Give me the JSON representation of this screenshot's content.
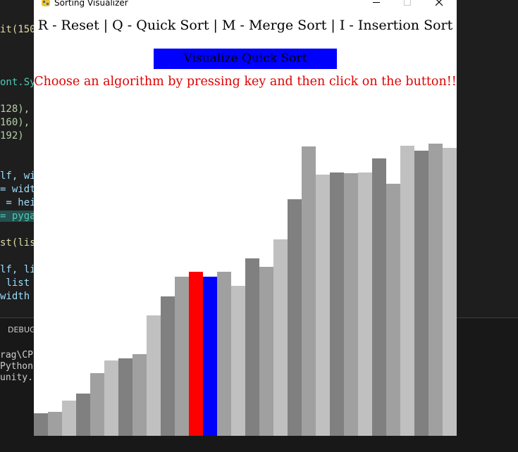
{
  "window": {
    "title": "Sorting Visualizer"
  },
  "controls": {
    "instructions": "R - Reset | Q - Quick Sort | M - Merge Sort | I - Insertion Sort",
    "visualize_button": "Visualize Quick Sort",
    "message": "Choose an algorithm by pressing key and then click on the button!!"
  },
  "bar_heights_fraction": [
    0.0533,
    0.0562,
    0.0831,
    0.0986,
    0.1467,
    0.1771,
    0.182,
    0.1917,
    0.2818,
    0.326,
    0.373,
    0.3839,
    0.373,
    0.3836,
    0.3515,
    0.4148,
    0.395,
    0.4591,
    0.5539,
    0.6765,
    0.6104,
    0.6154,
    0.6138,
    0.6154,
    0.6488,
    0.5891,
    0.6787,
    0.6666,
    0.683,
    0.6746
  ],
  "bar_colors": [
    "#808080",
    "#a0a0a0",
    "#c0c0c0",
    "#808080",
    "#a0a0a0",
    "#c0c0c0",
    "#808080",
    "#a0a0a0",
    "#c0c0c0",
    "#808080",
    "#a0a0a0",
    "#ff0000",
    "#0000ff",
    "#a0a0a0",
    "#c0c0c0",
    "#808080",
    "#a0a0a0",
    "#c0c0c0",
    "#808080",
    "#a0a0a0",
    "#c0c0c0",
    "#808080",
    "#a0a0a0",
    "#c0c0c0",
    "#808080",
    "#a0a0a0",
    "#c0c0c0",
    "#808080",
    "#a0a0a0",
    "#c0c0c0"
  ],
  "background": {
    "code_fragments": [
      "it(150",
      "ont.Sy",
      "128),",
      "160),",
      "192)",
      "lf, wi",
      "= widt",
      " = hei",
      "= pyga",
      "st(lis",
      "lf, li",
      " list",
      "width"
    ],
    "panel_tab": "DEBUG",
    "terminal_lines": [
      "rag\\CP",
      "Python",
      "unity."
    ]
  }
}
